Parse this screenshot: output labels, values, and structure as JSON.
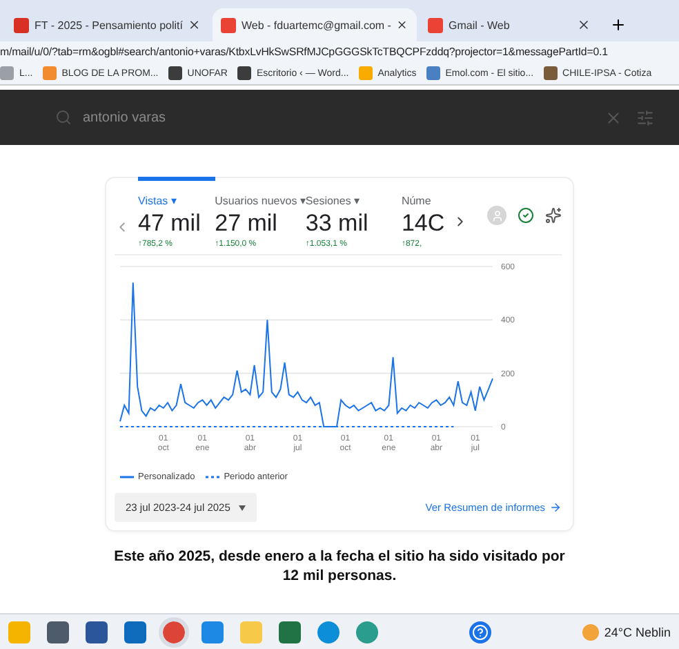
{
  "browser": {
    "tabs": [
      {
        "title": "FT - 2025 - Pensamiento polití",
        "selected": false
      },
      {
        "title": "Web - fduartemc@gmail.com -",
        "selected": true
      },
      {
        "title": "Gmail - Web",
        "selected": false
      }
    ],
    "address": "m/mail/u/0/?tab=rm&ogbl#search/antonio+varas/KtbxLvHkSwSRfMJCpGGGSkTcTBQCPFzddq?projector=1&messagePartId=0.1",
    "bookmarks": [
      {
        "title": "L...",
        "color": "#9aa0a6"
      },
      {
        "title": "BLOG DE LA PROM...",
        "color": "#f28b30"
      },
      {
        "title": "UNOFAR",
        "color": "#3c3c3c"
      },
      {
        "title": "Escritorio ‹ — Word...",
        "color": "#3c3c3c"
      },
      {
        "title": "Analytics",
        "color": "#f9ab00"
      },
      {
        "title": "Emol.com - El sitio...",
        "color": "#4a7fc1"
      },
      {
        "title": "CHILE-IPSA - Cotiza",
        "color": "#7a5c3a"
      }
    ]
  },
  "mail_search": {
    "value": "antonio varas"
  },
  "analytics": {
    "metrics": [
      {
        "label": "Vistas ▾",
        "value": "47 mil",
        "change": "↑785,2 %",
        "selected": true
      },
      {
        "label": "Usuarios nuevos ▾",
        "value": "27 mil",
        "change": "↑1.150,0 %",
        "selected": false
      },
      {
        "label": "Sesiones ▾",
        "value": "33 mil",
        "change": "↑1.053,1 %",
        "selected": false
      },
      {
        "label": "Núme",
        "value": "14C",
        "change": "↑872,",
        "selected": false
      }
    ],
    "chart_data": {
      "type": "line",
      "ylim": [
        0,
        600
      ],
      "yticks": [
        0,
        200,
        400,
        600
      ],
      "categories": [
        null,
        null,
        null,
        null,
        null,
        null,
        null,
        null,
        null,
        null,
        "01 oct",
        null,
        null,
        null,
        null,
        null,
        null,
        null,
        null,
        "01 ene",
        null,
        null,
        null,
        null,
        null,
        null,
        null,
        null,
        null,
        null,
        "01 abr",
        null,
        null,
        null,
        null,
        null,
        null,
        null,
        null,
        null,
        null,
        "01 jul",
        null,
        null,
        null,
        null,
        null,
        null,
        null,
        null,
        null,
        null,
        "01 oct",
        null,
        null,
        null,
        null,
        null,
        null,
        null,
        null,
        null,
        "01 ene",
        null,
        null,
        null,
        null,
        null,
        null,
        null,
        null,
        null,
        null,
        "01 abr",
        null,
        null,
        null,
        null,
        null,
        null,
        null,
        null,
        "01 jul",
        null,
        null,
        null,
        null
      ],
      "series": [
        {
          "name": "Personalizado",
          "color": "#1a73e8",
          "line_style": "solid",
          "values": [
            20,
            80,
            50,
            540,
            150,
            60,
            40,
            70,
            60,
            80,
            70,
            90,
            60,
            80,
            160,
            90,
            80,
            70,
            90,
            100,
            80,
            100,
            70,
            90,
            110,
            100,
            120,
            210,
            130,
            140,
            120,
            230,
            110,
            130,
            400,
            130,
            110,
            140,
            240,
            120,
            110,
            130,
            100,
            90,
            110,
            80,
            90,
            0,
            0,
            0,
            0,
            100,
            80,
            70,
            80,
            60,
            70,
            80,
            90,
            60,
            70,
            60,
            80,
            260,
            50,
            70,
            60,
            80,
            70,
            90,
            80,
            70,
            90,
            100,
            80,
            90,
            110,
            80,
            170,
            90,
            80,
            130,
            60,
            150,
            100,
            140,
            180
          ]
        },
        {
          "name": "Periodo anterior",
          "color": "#1a73e8",
          "line_style": "dashed",
          "values": [
            0,
            0,
            0,
            0,
            0,
            0,
            0,
            0,
            0,
            0,
            0,
            0,
            0,
            0,
            0,
            0,
            0,
            0,
            0,
            0,
            0,
            0,
            0,
            0,
            0,
            0,
            0,
            0,
            0,
            0,
            0,
            0,
            0,
            0,
            0,
            0,
            0,
            0,
            0,
            0,
            0,
            0,
            0,
            0,
            0,
            0,
            0,
            0,
            0,
            0,
            0,
            0,
            0,
            0,
            0,
            0,
            0,
            0,
            0,
            0,
            0,
            0,
            0,
            0,
            0,
            0,
            0,
            0,
            0,
            0,
            0,
            0,
            0,
            0,
            0,
            0,
            0,
            0,
            null,
            null,
            null,
            null,
            null,
            null,
            null,
            null,
            null
          ]
        }
      ]
    },
    "date_range": "23 jul 2023-24 jul 2025",
    "report_link": "Ver Resumen de informes"
  },
  "caption": "Este año 2025, desde enero a la fecha el sitio ha sido visitado por 12 mil personas.",
  "taskbar": {
    "apps": [
      {
        "kind": "widgets",
        "color": "#f4b400",
        "selected": false
      },
      {
        "kind": "taskview",
        "color": "#4d5b6a",
        "selected": false
      },
      {
        "kind": "word",
        "color": "#2b579a",
        "selected": false
      },
      {
        "kind": "outlook",
        "color": "#0f6cbd",
        "selected": false
      },
      {
        "kind": "chrome",
        "color": "#db4437",
        "selected": true
      },
      {
        "kind": "store",
        "color": "#1e88e5",
        "selected": false
      },
      {
        "kind": "files",
        "color": "#f7c948",
        "selected": false
      },
      {
        "kind": "excel",
        "color": "#217346",
        "selected": false
      },
      {
        "kind": "edge",
        "color": "#0c8fd8",
        "selected": false
      },
      {
        "kind": "app",
        "color": "#2a9d8f",
        "selected": false
      },
      {
        "kind": "help",
        "color": "#1a73e8",
        "selected": false
      }
    ],
    "weather": "24°C Neblin"
  }
}
